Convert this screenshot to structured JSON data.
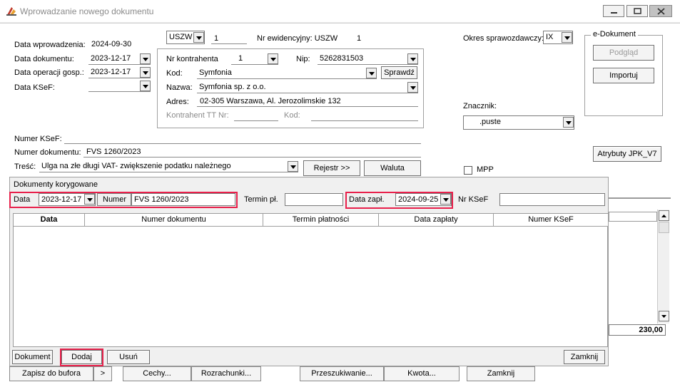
{
  "window": {
    "title": "Wprowadzanie nowego dokumentu"
  },
  "header": {
    "data_wprowadzenia_label": "Data wprowadzenia:",
    "data_wprowadzenia_value": "2024-09-30",
    "data_dokumentu_label": "Data dokumentu:",
    "data_dokumentu_value": "2023-12-17",
    "data_operacji_label": "Data operacji gosp.:",
    "data_operacji_value": "2023-12-17",
    "data_ksef_label": "Data KSeF:",
    "data_ksef_value": "",
    "rejestr_value": "USZW",
    "rejestr_num": "1",
    "nr_ewidencyjny_label": "Nr ewidencyjny: USZW",
    "nr_ewidencyjny_value": "1",
    "okres_label": "Okres sprawozdawczy:",
    "okres_value": "IX"
  },
  "kontrahent": {
    "nr_label": "Nr kontrahenta",
    "nr_value": "1",
    "nip_label": "Nip:",
    "nip_value": "5262831503",
    "kod_label": "Kod:",
    "kod_value": "Symfonia",
    "sprawdz_label": "Sprawdź",
    "nazwa_label": "Nazwa:",
    "nazwa_value": "Symfonia sp. z o.o.",
    "adres_label": "Adres:",
    "adres_value": "02-305 Warszawa, Al. Jerozolimskie 132",
    "tt_nr_label": "Kontrahent TT Nr:",
    "tt_kod_label": "Kod:"
  },
  "edokument": {
    "title": "e-Dokument",
    "podglad_label": "Podgląd",
    "importuj_label": "Importuj"
  },
  "znacznik": {
    "label": "Znacznik:",
    "value": ".puste"
  },
  "atrybuty_label": "Atrybuty JPK_V7",
  "mpp_label": "MPP",
  "numer_ksef_label": "Numer KSeF:",
  "numer_dokumentu_label": "Numer dokumentu:",
  "numer_dokumentu_value": "FVS 1260/2023",
  "tresc_label": "Treść:",
  "tresc_value": "Ulga na złe długi VAT- zwiększenie podatku należnego",
  "rejestr_button": "Rejestr >>",
  "waluta_button": "Waluta",
  "korygowane": {
    "title": "Dokumenty korygowane",
    "data_label": "Data",
    "data_value": "2023-12-17",
    "numer_label": "Numer",
    "numer_value": "FVS 1260/2023",
    "termin_label": "Termin pł.",
    "data_zapl_label": "Data zapł.",
    "data_zapl_value": "2024-09-25",
    "nr_ksef_label": "Nr KSeF",
    "columns": [
      "Data",
      "Numer dokumentu",
      "Termin płatności",
      "Data zapłaty",
      "Numer KSeF"
    ],
    "dokument_label": "Dokument",
    "dodaj_label": "Dodaj",
    "usun_label": "Usuń",
    "zamknij_label": "Zamknij"
  },
  "amount_value": "230,00",
  "bottom": {
    "zapisz_label": "Zapisz do bufora",
    "arrow_label": ">",
    "cechy_label": "Cechy...",
    "rozrachunki_label": "Rozrachunki...",
    "przeszukiwanie_label": "Przeszukiwanie...",
    "kwota_label": "Kwota...",
    "zamknij_label": "Zamknij"
  },
  "colors": {
    "highlight": "#e8204b"
  }
}
